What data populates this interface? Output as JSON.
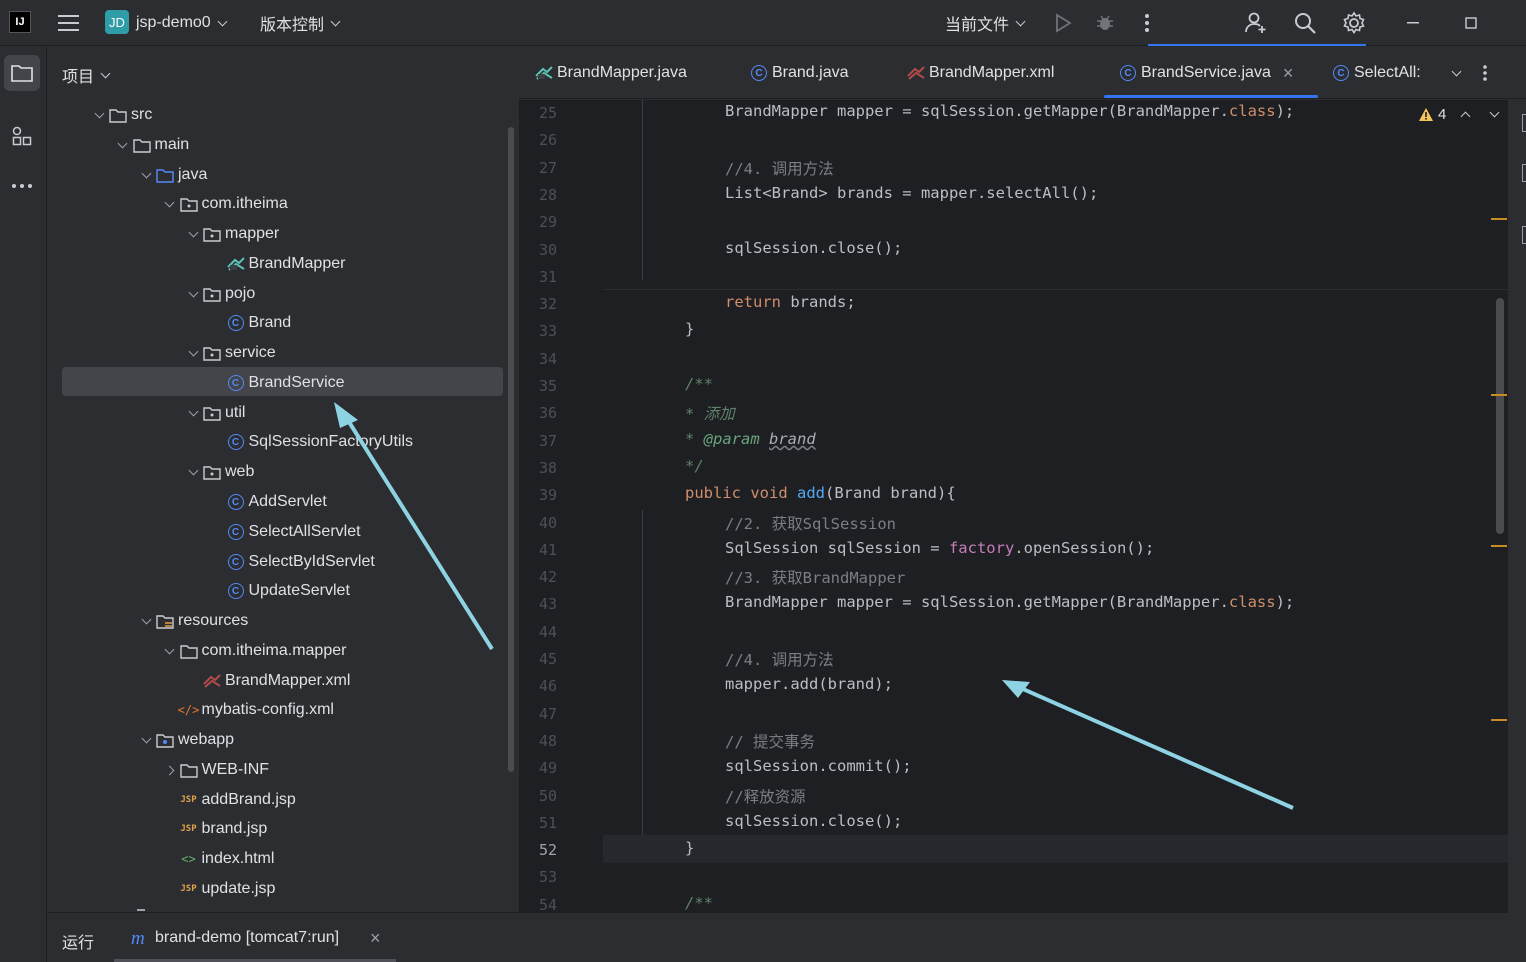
{
  "titlebar": {
    "logo": "IJ",
    "project_badge": "JD",
    "project_name": "jsp-demo0",
    "vcs_label": "版本控制",
    "run_config": "当前文件",
    "icons": [
      "menu-icon",
      "run-icon",
      "debug-icon",
      "more-vertical-icon",
      "add-user-icon",
      "search-icon",
      "settings-icon",
      "minimize-icon",
      "maximize-icon"
    ]
  },
  "project_panel": {
    "title": "项目",
    "tree": [
      {
        "label": "src",
        "icon": "folder",
        "expanded": true
      },
      {
        "label": "main",
        "icon": "folder",
        "expanded": true
      },
      {
        "label": "java",
        "icon": "source-folder",
        "expanded": true
      },
      {
        "label": "com.itheima",
        "icon": "package",
        "expanded": true
      },
      {
        "label": "mapper",
        "icon": "package",
        "expanded": true
      },
      {
        "label": "BrandMapper",
        "icon": "mapper"
      },
      {
        "label": "pojo",
        "icon": "package",
        "expanded": true
      },
      {
        "label": "Brand",
        "icon": "class"
      },
      {
        "label": "service",
        "icon": "package",
        "expanded": true
      },
      {
        "label": "BrandService",
        "icon": "class",
        "selected": true
      },
      {
        "label": "util",
        "icon": "package",
        "expanded": true
      },
      {
        "label": "SqlSessionFactoryUtils",
        "icon": "class"
      },
      {
        "label": "web",
        "icon": "package",
        "expanded": true
      },
      {
        "label": "AddServlet",
        "icon": "class"
      },
      {
        "label": "SelectAllServlet",
        "icon": "class"
      },
      {
        "label": "SelectByIdServlet",
        "icon": "class"
      },
      {
        "label": "UpdateServlet",
        "icon": "class"
      },
      {
        "label": "resources",
        "icon": "resources-folder",
        "expanded": true
      },
      {
        "label": "com.itheima.mapper",
        "icon": "folder",
        "expanded": true
      },
      {
        "label": "BrandMapper.xml",
        "icon": "mapper-xml"
      },
      {
        "label": "mybatis-config.xml",
        "icon": "xml"
      },
      {
        "label": "webapp",
        "icon": "web-folder",
        "expanded": true
      },
      {
        "label": "WEB-INF",
        "icon": "folder",
        "expanded": false
      },
      {
        "label": "addBrand.jsp",
        "icon": "jsp"
      },
      {
        "label": "brand.jsp",
        "icon": "jsp"
      },
      {
        "label": "index.html",
        "icon": "html"
      },
      {
        "label": "update.jsp",
        "icon": "jsp"
      }
    ]
  },
  "tabs": [
    {
      "label": "BrandMapper.java",
      "icon": "mapper"
    },
    {
      "label": "Brand.java",
      "icon": "class"
    },
    {
      "label": "BrandMapper.xml",
      "icon": "mapper-xml"
    },
    {
      "label": "BrandService.java",
      "icon": "class",
      "active": true,
      "close": "×"
    },
    {
      "label": "SelectAll:",
      "icon": "class"
    }
  ],
  "editor": {
    "warning_count": "4",
    "current_line": "52",
    "line_numbers": [
      "25",
      "26",
      "27",
      "28",
      "29",
      "30",
      "31",
      "32",
      "33",
      "34",
      "35",
      "36",
      "37",
      "38",
      "39",
      "40",
      "41",
      "42",
      "43",
      "44",
      "45",
      "46",
      "47",
      "48",
      "49",
      "50",
      "51",
      "52",
      "53",
      "54"
    ],
    "lines": [
      "BrandMapper mapper = sqlSession.getMapper(BrandMapper.class);",
      "",
      "//4. 调用方法",
      "List<Brand> brands = mapper.selectAll();",
      "",
      "sqlSession.close();",
      "",
      "return brands;",
      "}",
      "",
      "/**",
      "* 添加",
      "* @param brand",
      "*/",
      "public void add(Brand brand){",
      "//2. 获取SqlSession",
      "SqlSession sqlSession = factory.openSession();",
      "//3. 获取BrandMapper",
      "BrandMapper mapper = sqlSession.getMapper(BrandMapper.class);",
      "",
      "//4. 调用方法",
      "mapper.add(brand);",
      "",
      "// 提交事务",
      "sqlSession.commit();",
      "//释放资源",
      "sqlSession.close();",
      "}",
      "",
      "/**"
    ]
  },
  "bottom": {
    "run_label": "运行",
    "run_tab": "brand-demo [tomcat7:run]",
    "close": "×"
  },
  "colors": {
    "accent": "#3574f0",
    "arrow": "#8ed3e4",
    "keyword": "#cf8e6d",
    "function": "#56a8f5",
    "field": "#c77dbb"
  }
}
